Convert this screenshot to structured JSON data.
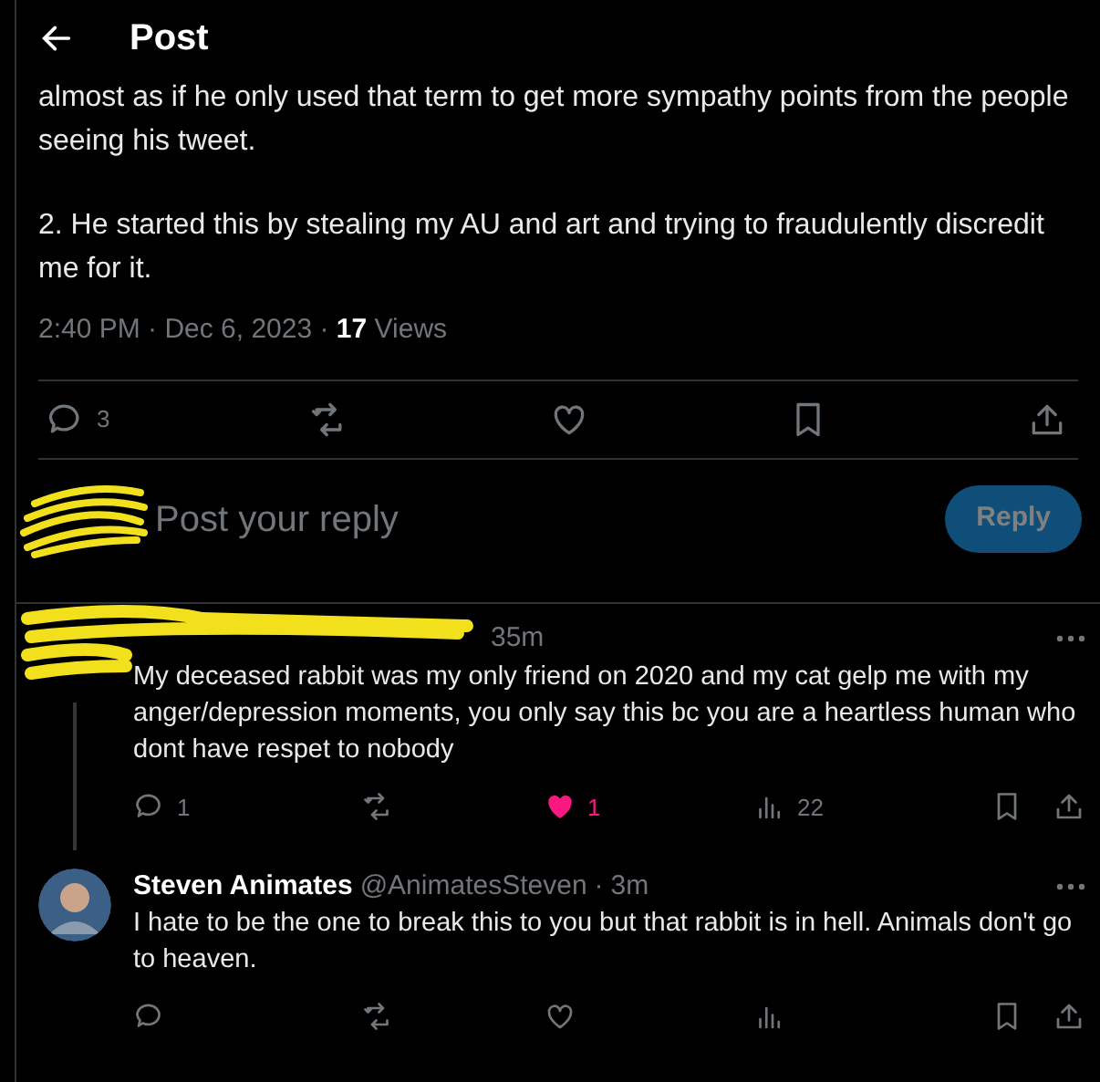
{
  "header": {
    "title": "Post"
  },
  "post": {
    "paragraphs": [
      "almost as if he only used that term to get more sympathy points from the people seeing his tweet.",
      "2. He started this by stealing my AU and art and trying to fraudulently discredit me for it."
    ],
    "timestamp": "2:40 PM · Dec 6, 2023 · ",
    "views_count": "17",
    "views_label": "Views",
    "actions": {
      "reply_count": "3",
      "liked": false,
      "bookmarked": false
    }
  },
  "compose": {
    "placeholder": "Post your reply",
    "button": "Reply",
    "button_disabled": true
  },
  "replies": [
    {
      "redacted": true,
      "time": "35m",
      "text": "My deceased rabbit was my only friend on 2020 and my cat gelp me with my anger/depression moments, you only say this bc you are a heartless human who dont have respet to nobody",
      "reply_count": "1",
      "like_count": "1",
      "liked": true,
      "view_count": "22",
      "thread_line": true
    },
    {
      "redacted": false,
      "name": "Steven Animates",
      "handle": "@AnimatesSteven",
      "separator": "·",
      "time": "3m",
      "text": "I hate to be the one to break this to you but that rabbit is in hell. Animals don't go to heaven.",
      "liked": false,
      "thread_line": false
    }
  ]
}
